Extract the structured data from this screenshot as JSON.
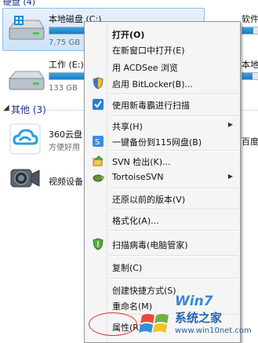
{
  "explorer": {
    "hard_disks_header": "硬盘 (4)",
    "drives": [
      {
        "label": "本地磁盘 (C:)",
        "size": "7.75 GB",
        "fill": 0.92
      },
      {
        "label": "软件",
        "size": "",
        "fill": 0.6
      },
      {
        "label": "工作 (E:)",
        "size": "133 GB",
        "fill": 0.25
      },
      {
        "label": "本地",
        "size": "",
        "fill": 0.55
      }
    ],
    "other_header": "其他 (3)",
    "others": [
      {
        "label": "360云盘",
        "sub": "方便好用"
      },
      {
        "label": "视频设备",
        "sub": ""
      },
      {
        "label": "百度云",
        "sub": ""
      }
    ]
  },
  "context_menu": {
    "items": [
      {
        "label": "打开(O)",
        "bold": true
      },
      {
        "label": "在新窗口中打开(E)"
      },
      {
        "label": "用 ACDSee 浏览"
      },
      {
        "label": "启用 BitLocker(B)..."
      },
      {
        "label": "使用新毒霸进行扫描"
      },
      {
        "label": "共享(H)",
        "submenu": true
      },
      {
        "label": "一键备份到115网盘(B)"
      },
      {
        "label": "SVN 检出(K)..."
      },
      {
        "label": "TortoiseSVN",
        "submenu": true
      },
      {
        "label": "还原以前的版本(V)"
      },
      {
        "label": "格式化(A)..."
      },
      {
        "label": "扫描病毒(电脑管家)"
      },
      {
        "label": "复制(C)"
      },
      {
        "label": "创建快捷方式(S)"
      },
      {
        "label": "重命名(M)"
      },
      {
        "label": "属性(R)"
      }
    ]
  },
  "watermark": {
    "brand": "系统之家",
    "url": "www.win10net.com",
    "logo_text": "Win7"
  },
  "colors": {
    "accent": "#1b7cc0",
    "highlight_oval": "#d8353a"
  }
}
